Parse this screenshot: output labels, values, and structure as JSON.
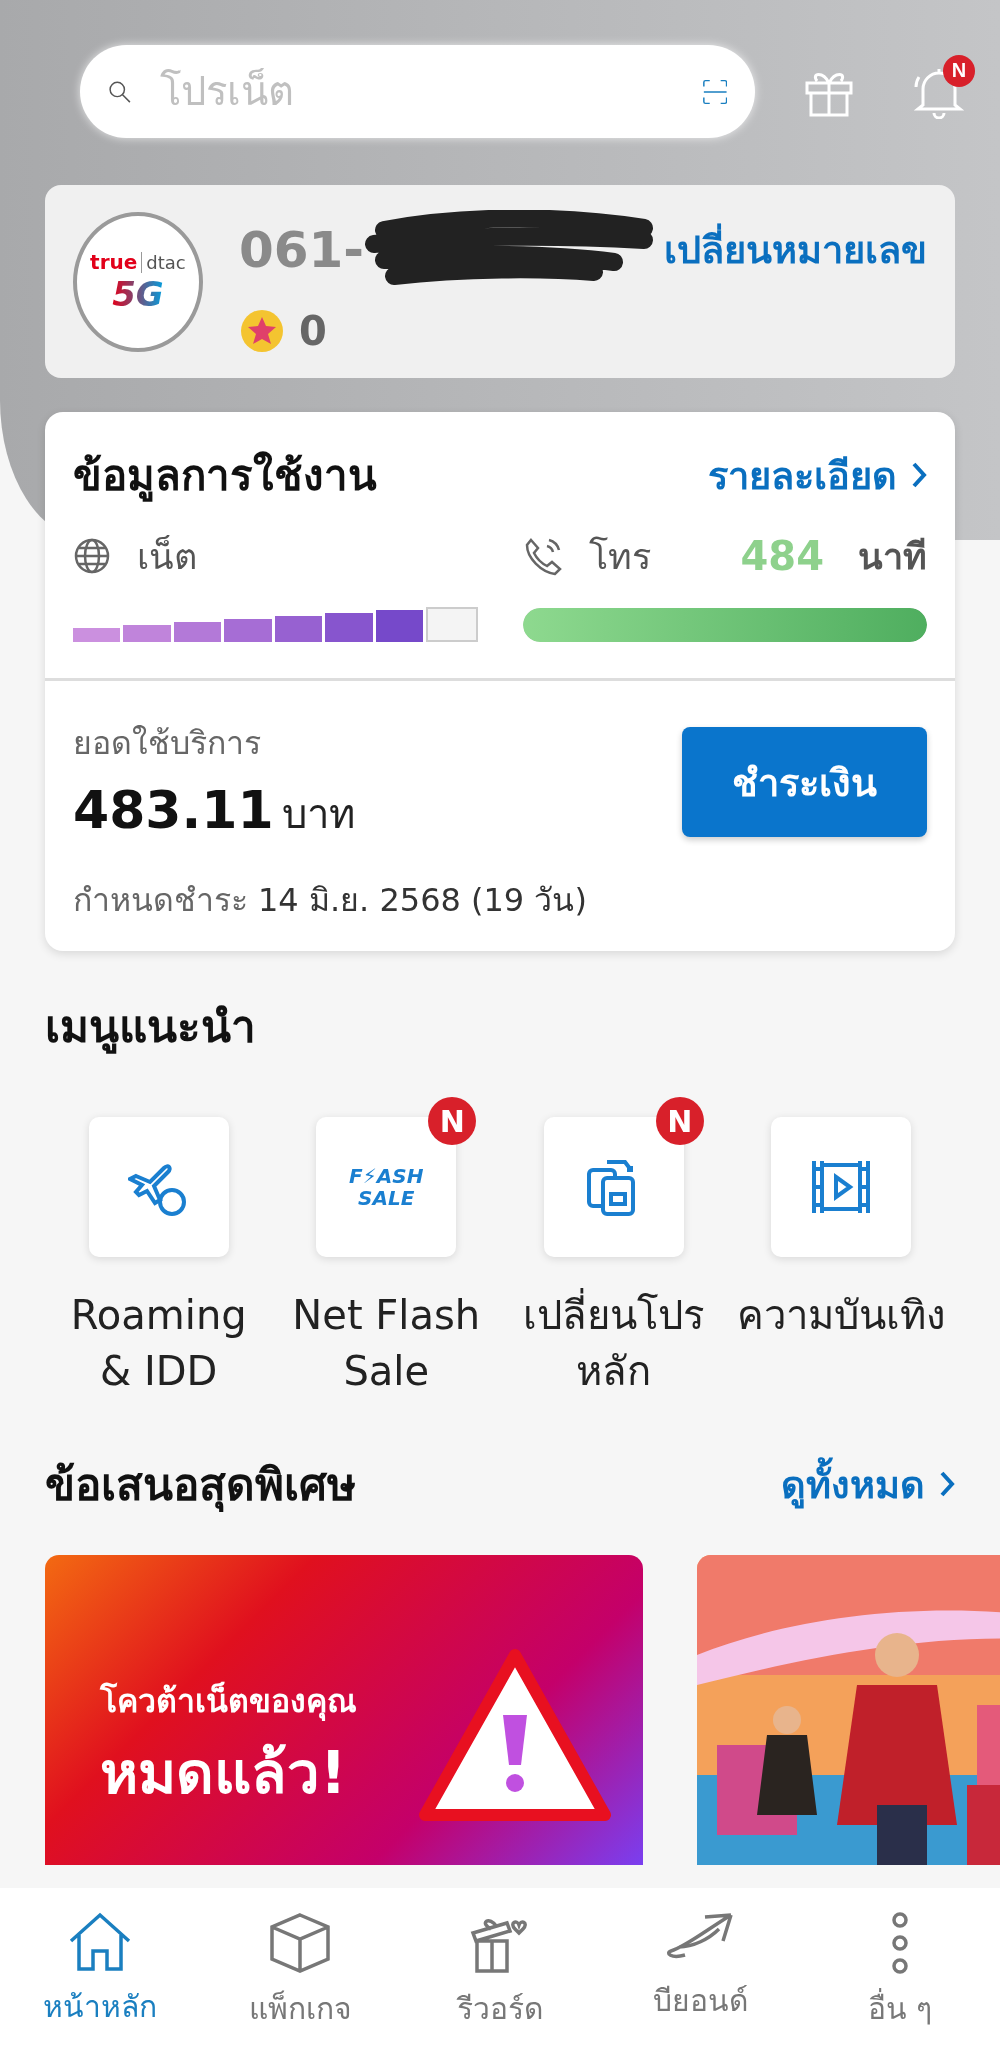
{
  "search": {
    "placeholder": "โปรเน็ต"
  },
  "header": {
    "notification_badge": "N"
  },
  "account": {
    "logo": {
      "brand_1": "true",
      "brand_2": "dtac",
      "network": "5G"
    },
    "number": "061-",
    "number_redacted": true,
    "change_number_link": "เปลี่ยนหมายเลข",
    "points": "0"
  },
  "usage": {
    "title": "ข้อมูลการใช้งาน",
    "details_link": "รายละเอียด",
    "internet": {
      "label": "เน็ต",
      "level": 0.875
    },
    "calls": {
      "label": "โทร",
      "amount": "484",
      "unit": "นาที",
      "level": 1
    },
    "bill": {
      "label": "ยอดใช้บริการ",
      "amount": "483.11",
      "currency": "บาท",
      "due_label": "กำหนดชำระ",
      "due_date": "14 มิ.ย. 2568 (19 วัน)",
      "pay_button": "ชำระเงิน"
    }
  },
  "menu": {
    "title": "เมนูแนะนำ",
    "items": [
      {
        "kind": "roaming",
        "label": "Roaming\n& IDD"
      },
      {
        "kind": "flash",
        "label": "Net Flash\nSale",
        "icon_text": "F⚡ASH\nSALE",
        "badge": "N"
      },
      {
        "kind": "sim",
        "label": "เปลี่ยนโปร\nหลัก",
        "badge": "N"
      },
      {
        "kind": "video",
        "label": "ความบันเทิง"
      }
    ]
  },
  "offers": {
    "title": "ข้อเสนอสุดพิเศษ",
    "see_all": "ดูทั้งหมด",
    "cards": [
      {
        "kind": "banner",
        "headline_1": "โควต้าเน็ตของคุณ",
        "headline_2": "หมดแล้ว!"
      },
      {
        "kind": "picture"
      }
    ]
  },
  "nav": [
    {
      "kind": "home",
      "label": "หน้าหลัก",
      "selected": true
    },
    {
      "kind": "package",
      "label": "แพ็กเกจ",
      "selected": false
    },
    {
      "kind": "reward",
      "label": "รีวอร์ด",
      "selected": false
    },
    {
      "kind": "beyond",
      "label": "บียอนด์",
      "selected": false
    },
    {
      "kind": "more",
      "label": "อื่น ๆ",
      "selected": false
    }
  ]
}
